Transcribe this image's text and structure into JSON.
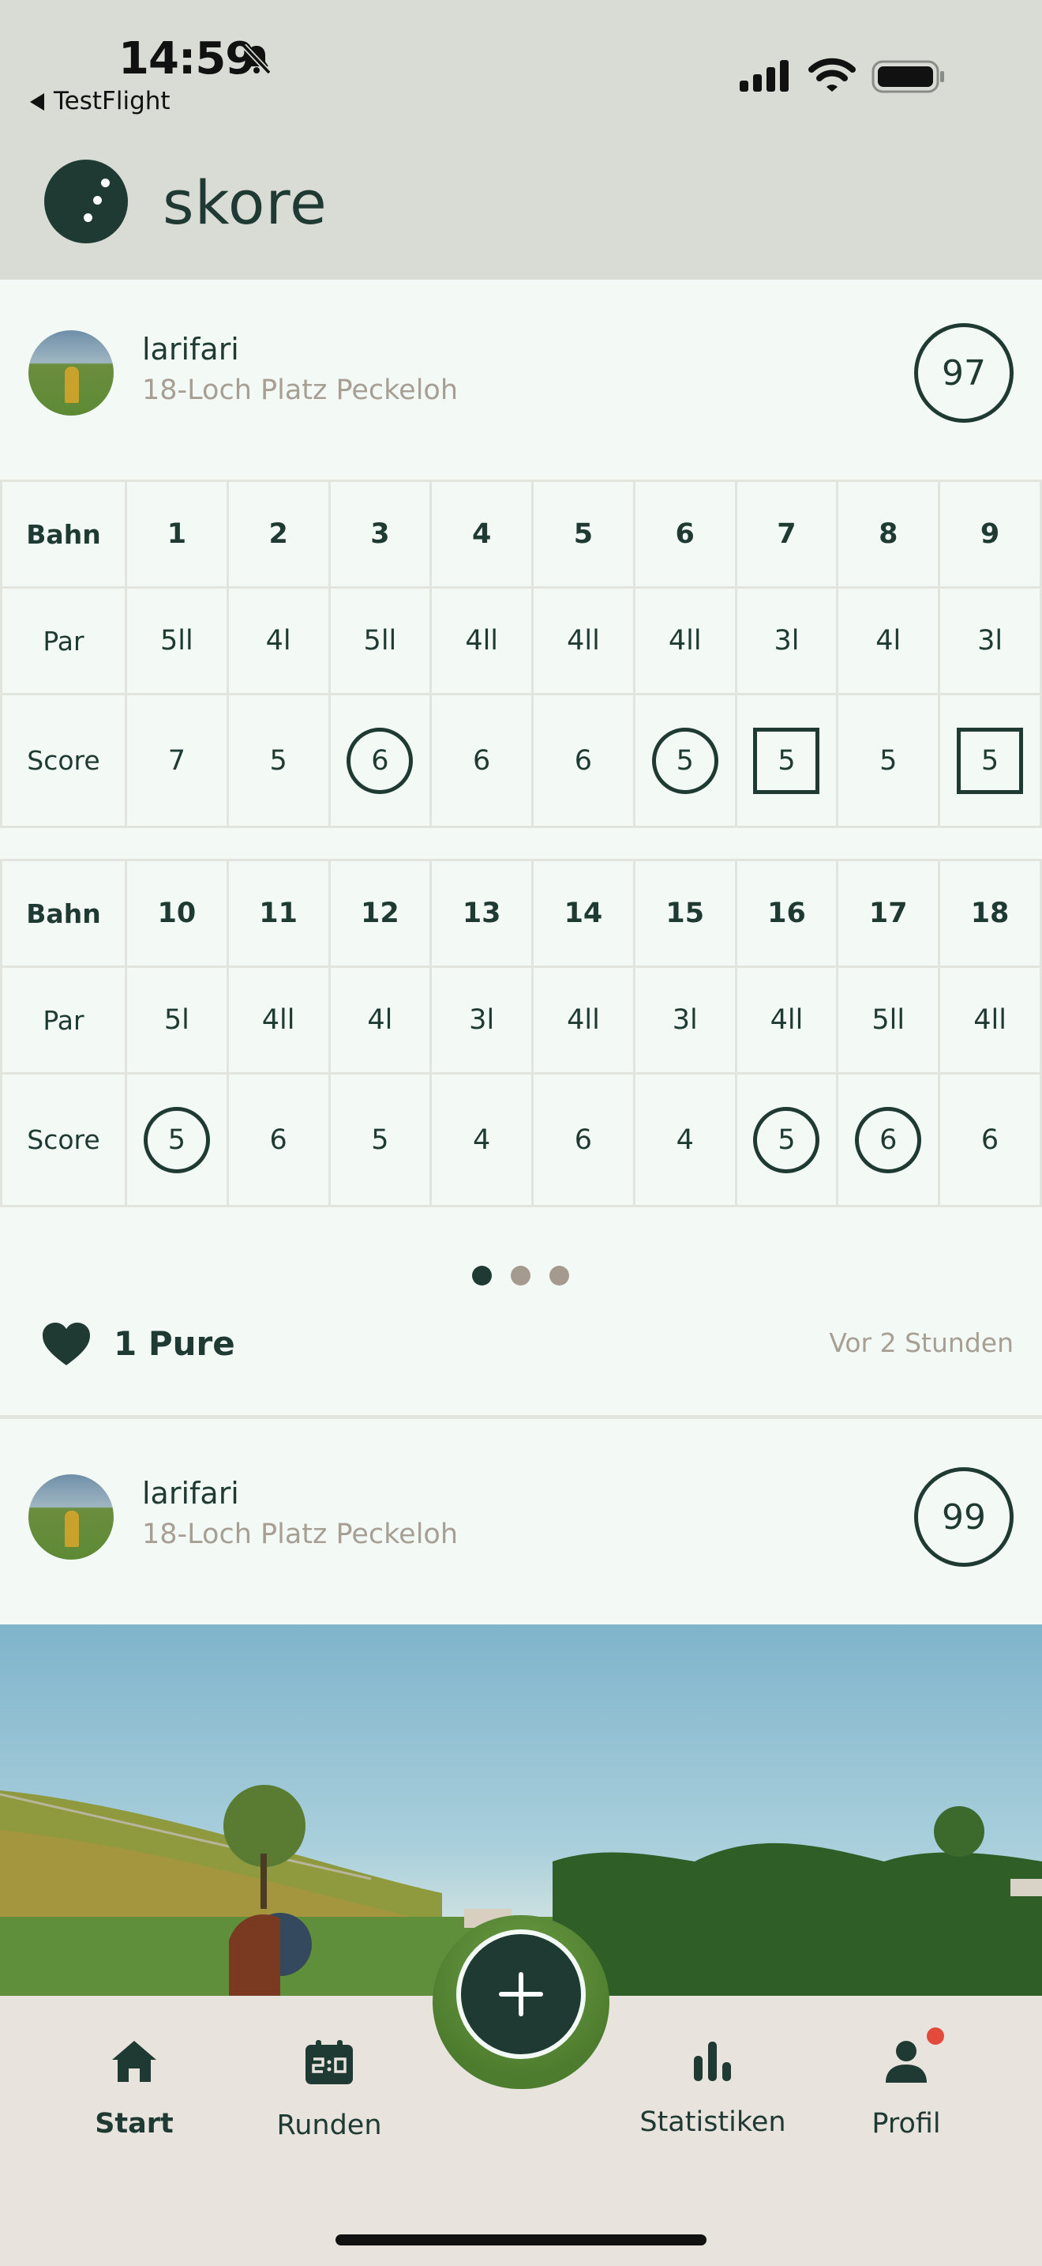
{
  "status": {
    "time": "14:59",
    "back_app": "TestFlight"
  },
  "app": {
    "title": "skore"
  },
  "round1": {
    "username": "larifari",
    "course": "18-Loch Platz Peckeloh",
    "total": "97",
    "front": {
      "hole_label": "Bahn",
      "par_label": "Par",
      "score_label": "Score",
      "holes": [
        "1",
        "2",
        "3",
        "4",
        "5",
        "6",
        "7",
        "8",
        "9"
      ],
      "pars": [
        "5ll",
        "4l",
        "5ll",
        "4ll",
        "4ll",
        "4ll",
        "3l",
        "4l",
        "3l"
      ],
      "scores": [
        "7",
        "5",
        "6",
        "6",
        "6",
        "5",
        "5",
        "5",
        "5"
      ],
      "marks": [
        "none",
        "none",
        "circle",
        "none",
        "none",
        "circle",
        "square",
        "none",
        "square"
      ]
    },
    "back": {
      "hole_label": "Bahn",
      "par_label": "Par",
      "score_label": "Score",
      "holes": [
        "10",
        "11",
        "12",
        "13",
        "14",
        "15",
        "16",
        "17",
        "18"
      ],
      "pars": [
        "5l",
        "4ll",
        "4l",
        "3l",
        "4ll",
        "3l",
        "4ll",
        "5ll",
        "4ll"
      ],
      "scores": [
        "5",
        "6",
        "5",
        "4",
        "6",
        "4",
        "5",
        "6",
        "6"
      ],
      "marks": [
        "circle",
        "none",
        "none",
        "none",
        "none",
        "none",
        "circle",
        "circle",
        "none"
      ]
    },
    "pager": {
      "count": 3,
      "active": 0
    },
    "likes": "1 Pure",
    "time_ago": "Vor 2 Stunden"
  },
  "round2": {
    "username": "larifari",
    "course": "18-Loch Platz Peckeloh",
    "total": "99"
  },
  "nav": {
    "items": [
      {
        "label": "Start",
        "icon": "home-icon",
        "active": true
      },
      {
        "label": "Runden",
        "icon": "scoreboard-icon",
        "active": false
      },
      {
        "label": "Statistiken",
        "icon": "bar-chart-icon",
        "active": false
      },
      {
        "label": "Profil",
        "icon": "person-icon",
        "active": false,
        "badge": true
      }
    ],
    "fab_icon": "plus-icon"
  },
  "colors": {
    "accent": "#1f3a33",
    "muted": "#a79f94",
    "badge": "#e24a3c",
    "header_bg": "#d9dbd5",
    "nav_bg": "#e8e4dd"
  }
}
